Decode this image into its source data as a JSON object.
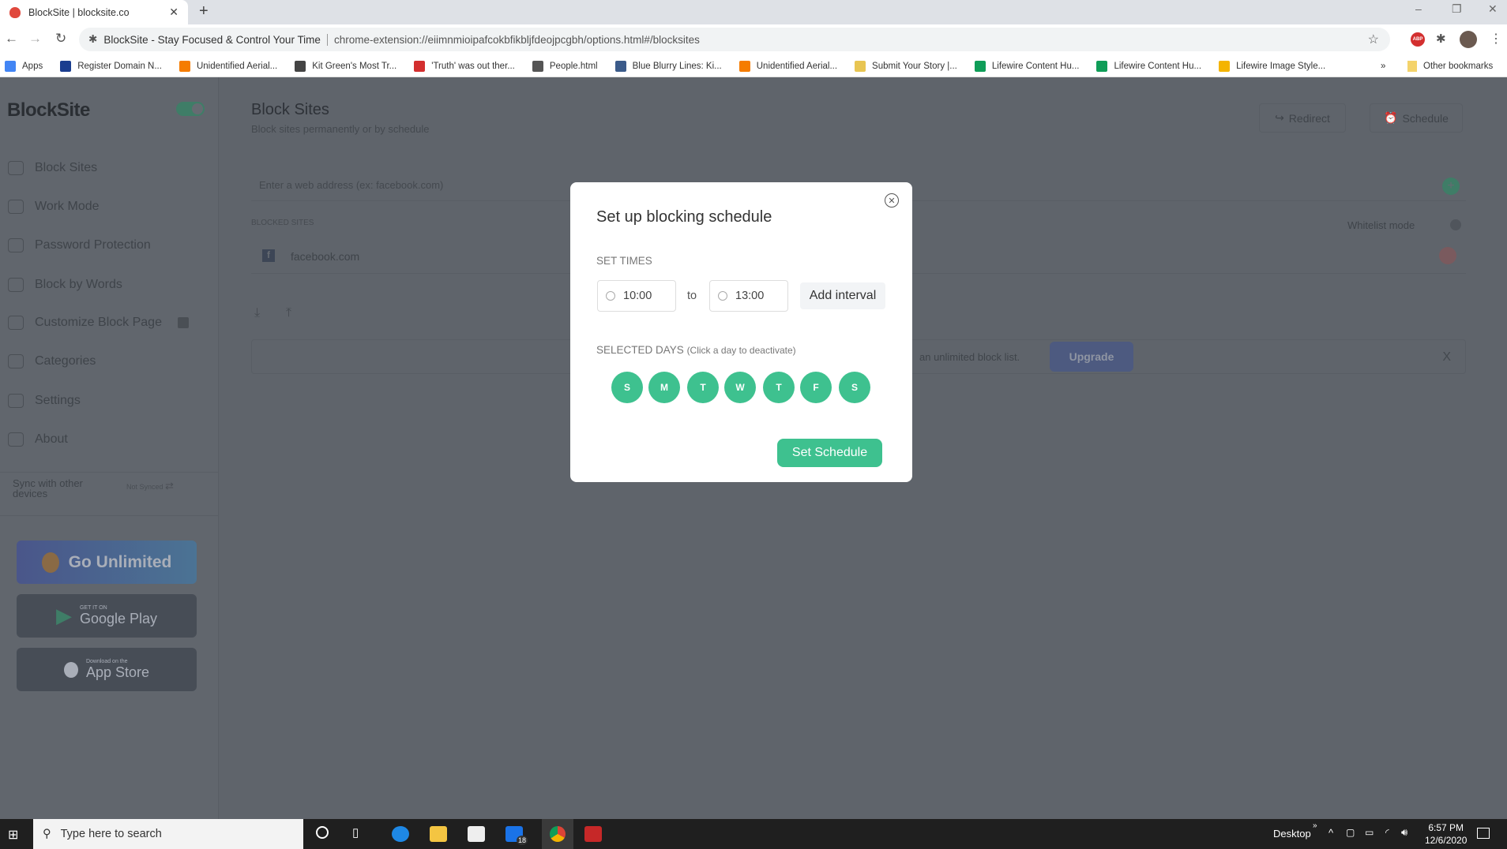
{
  "browser": {
    "tab_title": "BlockSite | blocksite.co",
    "page_title": "BlockSite - Stay Focused & Control Your Time",
    "url": "chrome-extension://eiimnmioipafcokbfikbljfdeojpcgbh/options.html#/blocksites",
    "bookmarks": [
      {
        "label": "Apps",
        "color": "#4285f4"
      },
      {
        "label": "Register Domain N...",
        "color": "#1a3d8f"
      },
      {
        "label": "Unidentified Aerial...",
        "color": "#f57c00"
      },
      {
        "label": "Kit Green's Most Tr...",
        "color": "#444444"
      },
      {
        "label": "'Truth' was out ther...",
        "color": "#d32f2f"
      },
      {
        "label": "People.html",
        "color": "#555555"
      },
      {
        "label": "Blue Blurry Lines: Ki...",
        "color": "#3b5b8a"
      },
      {
        "label": "Unidentified Aerial...",
        "color": "#f57c00"
      },
      {
        "label": "Submit Your Story |...",
        "color": "#e8c552"
      },
      {
        "label": "Lifewire Content Hu...",
        "color": "#0f9d58"
      },
      {
        "label": "Lifewire Content Hu...",
        "color": "#0f9d58"
      },
      {
        "label": "Lifewire Image Style...",
        "color": "#f4b400"
      }
    ],
    "overflow": "»",
    "other_bookmarks": "Other bookmarks"
  },
  "sidebar": {
    "logo": "BlockSite",
    "enabled": true,
    "items": [
      {
        "label": "Block Sites",
        "icon": "shield-icon"
      },
      {
        "label": "Work Mode",
        "icon": "briefcase-icon"
      },
      {
        "label": "Password Protection",
        "icon": "lock-icon"
      },
      {
        "label": "Block by Words",
        "icon": "chat-icon"
      },
      {
        "label": "Customize Block Page",
        "icon": "brush-icon"
      },
      {
        "label": "Categories",
        "icon": "grid-icon"
      },
      {
        "label": "Settings",
        "icon": "gear-icon"
      },
      {
        "label": "About",
        "icon": "info-icon"
      }
    ],
    "sync_label": "Sync with other devices",
    "sync_status": "Not Synced",
    "go_unlimited": "Go Unlimited",
    "google_play_small": "GET IT ON",
    "google_play": "Google Play",
    "app_store_small": "Download on the",
    "app_store": "App Store"
  },
  "main": {
    "title": "Block Sites",
    "subtitle": "Block sites permanently or by schedule",
    "redirect": "Redirect",
    "schedule": "Schedule",
    "input_placeholder": "Enter a web address (ex: facebook.com)",
    "blocked_label": "BLOCKED SITES",
    "whitelist": "Whitelist mode",
    "sites": [
      "facebook.com"
    ],
    "banner_text": "an unlimited block list.",
    "upgrade": "Upgrade",
    "banner_close": "X"
  },
  "modal": {
    "title": "Set up blocking schedule",
    "set_times": "SET TIMES",
    "from": "10:00",
    "to_label": "to",
    "to": "13:00",
    "add_interval": "Add interval",
    "selected_days": "SELECTED DAYS",
    "selected_days_hint": "(Click a day to deactivate)",
    "days": [
      "S",
      "M",
      "T",
      "W",
      "T",
      "F",
      "S"
    ],
    "submit": "Set Schedule",
    "accent": "#3ec18f"
  },
  "taskbar": {
    "search_placeholder": "Type here to search",
    "mail_badge": "18",
    "desktop": "Desktop",
    "time": "6:57 PM",
    "date": "12/6/2020"
  }
}
